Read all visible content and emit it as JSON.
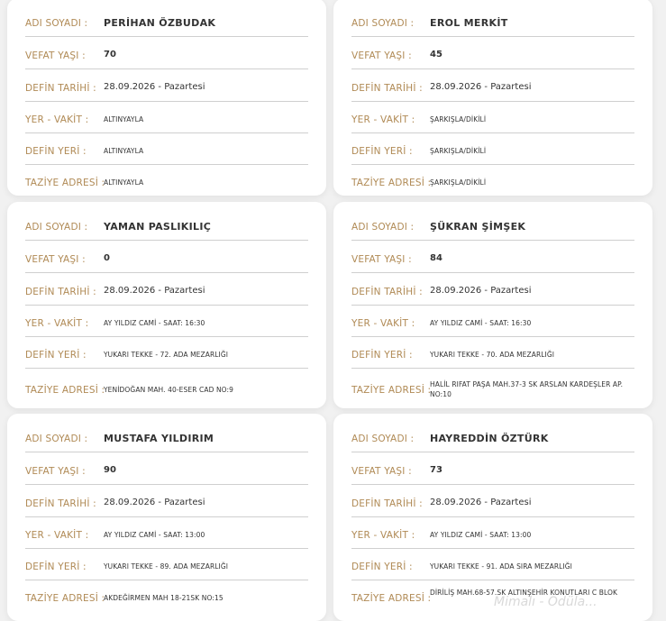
{
  "labels": {
    "name": "ADI SOYADI :",
    "age": "VEFAT YAŞI :",
    "date": "DEFİN TARİHİ :",
    "place_time": "YER - VAKİT :",
    "burial": "DEFİN YERİ :",
    "condolence": "TAZİYE ADRESİ :"
  },
  "cards": [
    {
      "name": "PERİHAN ÖZBUDAK",
      "age": "70",
      "date": "28.09.2026 - Pazartesi",
      "place_time": "ALTINYAYLA",
      "burial": "ALTINYAYLA",
      "condolence": "ALTINYAYLA"
    },
    {
      "name": "EROL MERKİT",
      "age": "45",
      "date": "28.09.2026 - Pazartesi",
      "place_time": "ŞARKIŞLA/DİKİLİ",
      "burial": "ŞARKIŞLA/DİKİLİ",
      "condolence": "ŞARKIŞLA/DİKİLİ"
    },
    {
      "name": "YAMAN PASLIKILIÇ",
      "age": "0",
      "date": "28.09.2026 - Pazartesi",
      "place_time": "AY YILDIZ CAMİ - SAAT: 16:30",
      "burial": "YUKARI TEKKE - 72. ADA MEZARLIĞI",
      "condolence": "YENİDOĞAN MAH. 40-ESER CAD NO:9"
    },
    {
      "name": "ŞÜKRAN ŞİMŞEK",
      "age": "84",
      "date": "28.09.2026 - Pazartesi",
      "place_time": "AY YILDIZ CAMİ - SAAT: 16:30",
      "burial": "YUKARI TEKKE - 70. ADA MEZARLIĞI",
      "condolence": "HALİL RIFAT PAŞA MAH.37-3 SK ARSLAN KARDEŞLER AP. NO:10"
    },
    {
      "name": "MUSTAFA YILDIRIM",
      "age": "90",
      "date": "28.09.2026 - Pazartesi",
      "place_time": "AY YILDIZ CAMİ - SAAT: 13:00",
      "burial": "YUKARI TEKKE - 89. ADA MEZARLIĞI",
      "condolence": "AKDEĞİRMEN MAH 18-21SK NO:15"
    },
    {
      "name": "HAYREDDİN ÖZTÜRK",
      "age": "73",
      "date": "28.09.2026 - Pazartesi",
      "place_time": "AY YILDIZ CAMİ - SAAT: 13:00",
      "burial": "YUKARI TEKKE - 91. ADA SIRA MEZARLIĞI",
      "condolence": "DİRİLİŞ MAH.68-57.SK ALTINŞEHİR KONUTLARI C BLOK"
    }
  ],
  "watermark": "Mimalı - Ödüla..."
}
